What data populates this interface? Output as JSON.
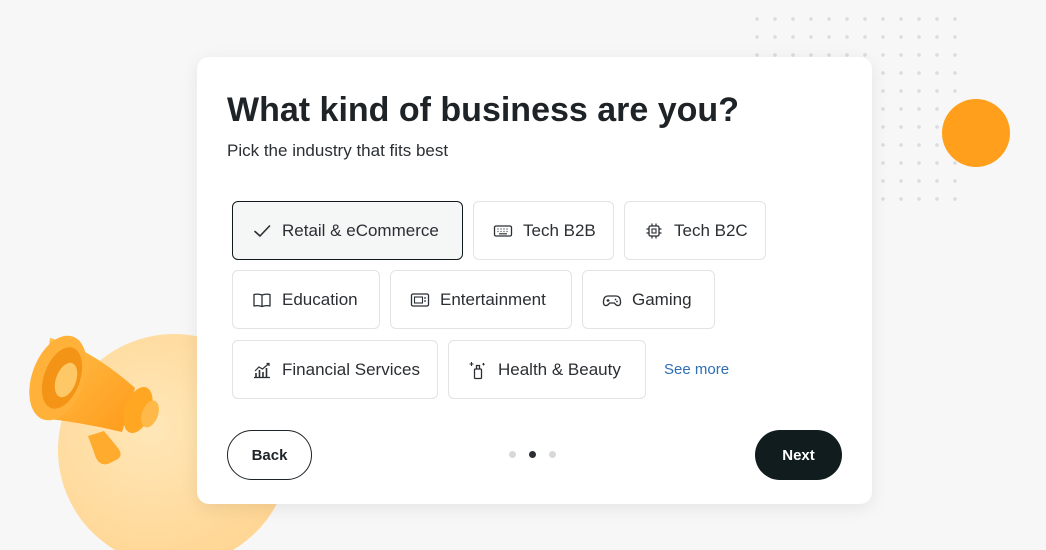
{
  "heading": "What kind of business are you?",
  "subheading": "Pick the industry that fits best",
  "industries": [
    {
      "label": "Retail & eCommerce",
      "icon": "check-icon",
      "selected": true
    },
    {
      "label": "Tech B2B",
      "icon": "keyboard-icon",
      "selected": false
    },
    {
      "label": "Tech B2C",
      "icon": "chip-icon",
      "selected": false
    },
    {
      "label": "Education",
      "icon": "book-icon",
      "selected": false
    },
    {
      "label": "Entertainment",
      "icon": "tv-icon",
      "selected": false
    },
    {
      "label": "Gaming",
      "icon": "gamepad-icon",
      "selected": false
    },
    {
      "label": "Financial Services",
      "icon": "chart-icon",
      "selected": false
    },
    {
      "label": "Health & Beauty",
      "icon": "cosmetics-icon",
      "selected": false
    }
  ],
  "see_more": "See more",
  "buttons": {
    "back": "Back",
    "next": "Next"
  },
  "pagination": {
    "total": 3,
    "current": 2
  },
  "colors": {
    "accent": "#ff9f1c",
    "primary_button": "#101c1e",
    "link": "#2e6fb3"
  }
}
